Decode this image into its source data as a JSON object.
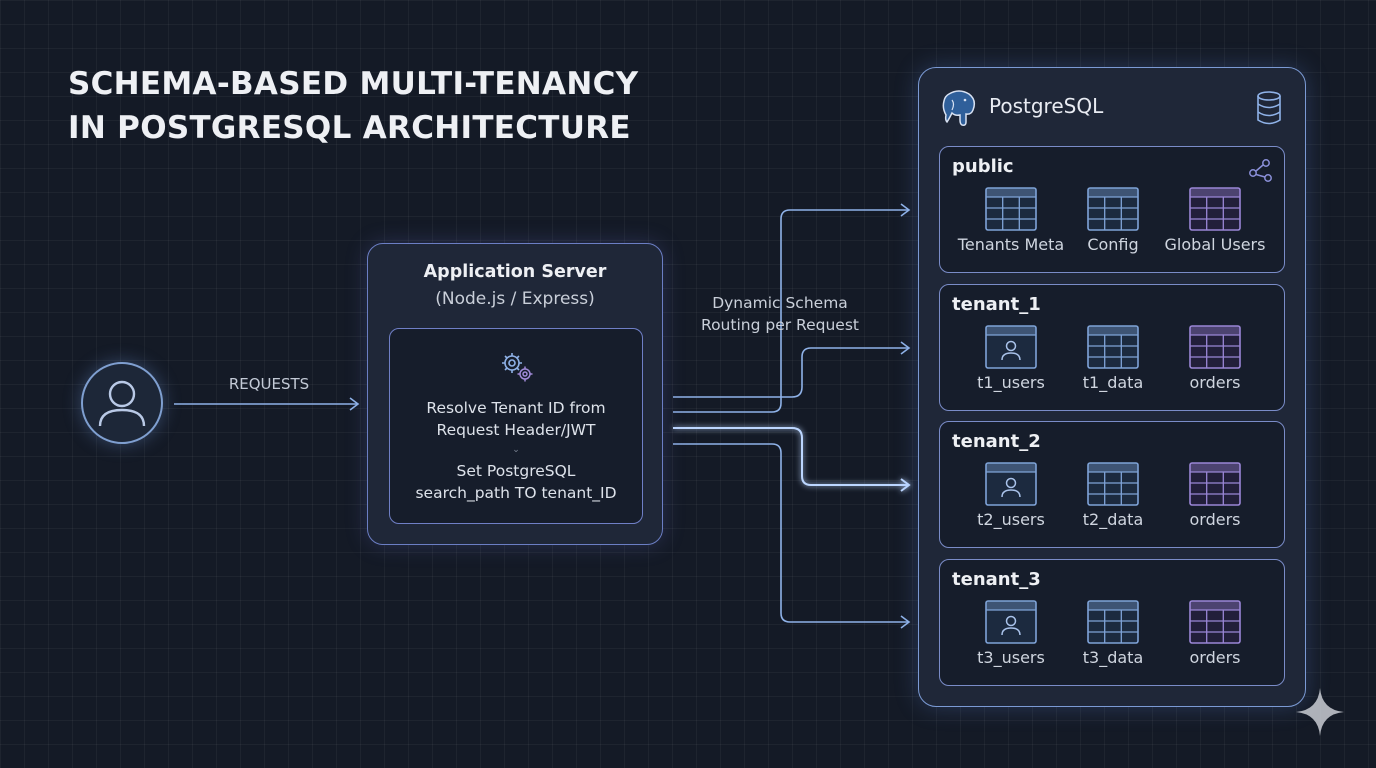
{
  "title": {
    "line1": "SCHEMA-BASED MULTI-TENANCY",
    "line2": "IN POSTGRESQL ARCHITECTURE"
  },
  "client": {
    "icon": "user-avatar-icon",
    "requests_label": "REQUESTS"
  },
  "routing": {
    "line1": "Dynamic Schema",
    "line2": "Routing per Request"
  },
  "app_server": {
    "title": "Application Server",
    "subtitle": "(Node.js / Express)",
    "icon": "gears-icon",
    "step1_line1": "Resolve Tenant ID from",
    "step1_line2": "Request Header/JWT",
    "step2_line1": "Set PostgreSQL",
    "step2_line2": "search_path TO tenant_ID"
  },
  "database": {
    "title": "PostgreSQL",
    "logo": "postgresql-elephant-icon",
    "icon": "database-icon",
    "schemas": [
      {
        "name": "public",
        "tables": [
          {
            "label": "Tenants Meta",
            "icon": "table-icon"
          },
          {
            "label": "Config",
            "icon": "table-icon"
          },
          {
            "label": "Global Users",
            "icon": "table-icon"
          }
        ]
      },
      {
        "name": "tenant_1",
        "tables": [
          {
            "label": "t1_users",
            "icon": "user-table-icon"
          },
          {
            "label": "t1_data",
            "icon": "table-icon"
          },
          {
            "label": "orders",
            "icon": "table-icon"
          }
        ]
      },
      {
        "name": "tenant_2",
        "tables": [
          {
            "label": "t2_users",
            "icon": "user-table-icon"
          },
          {
            "label": "t2_data",
            "icon": "table-icon"
          },
          {
            "label": "orders",
            "icon": "table-icon"
          }
        ]
      },
      {
        "name": "tenant_3",
        "tables": [
          {
            "label": "t3_users",
            "icon": "user-table-icon"
          },
          {
            "label": "t3_data",
            "icon": "table-icon"
          },
          {
            "label": "orders",
            "icon": "table-icon"
          }
        ]
      }
    ]
  },
  "colors": {
    "background": "#141a26",
    "wire": "#8fb2e8",
    "wire_highlight": "#bcd6ff",
    "panel_border": "#7b9ad4",
    "table_blue": "#7fa3d8",
    "table_purple": "#9a86d6"
  }
}
